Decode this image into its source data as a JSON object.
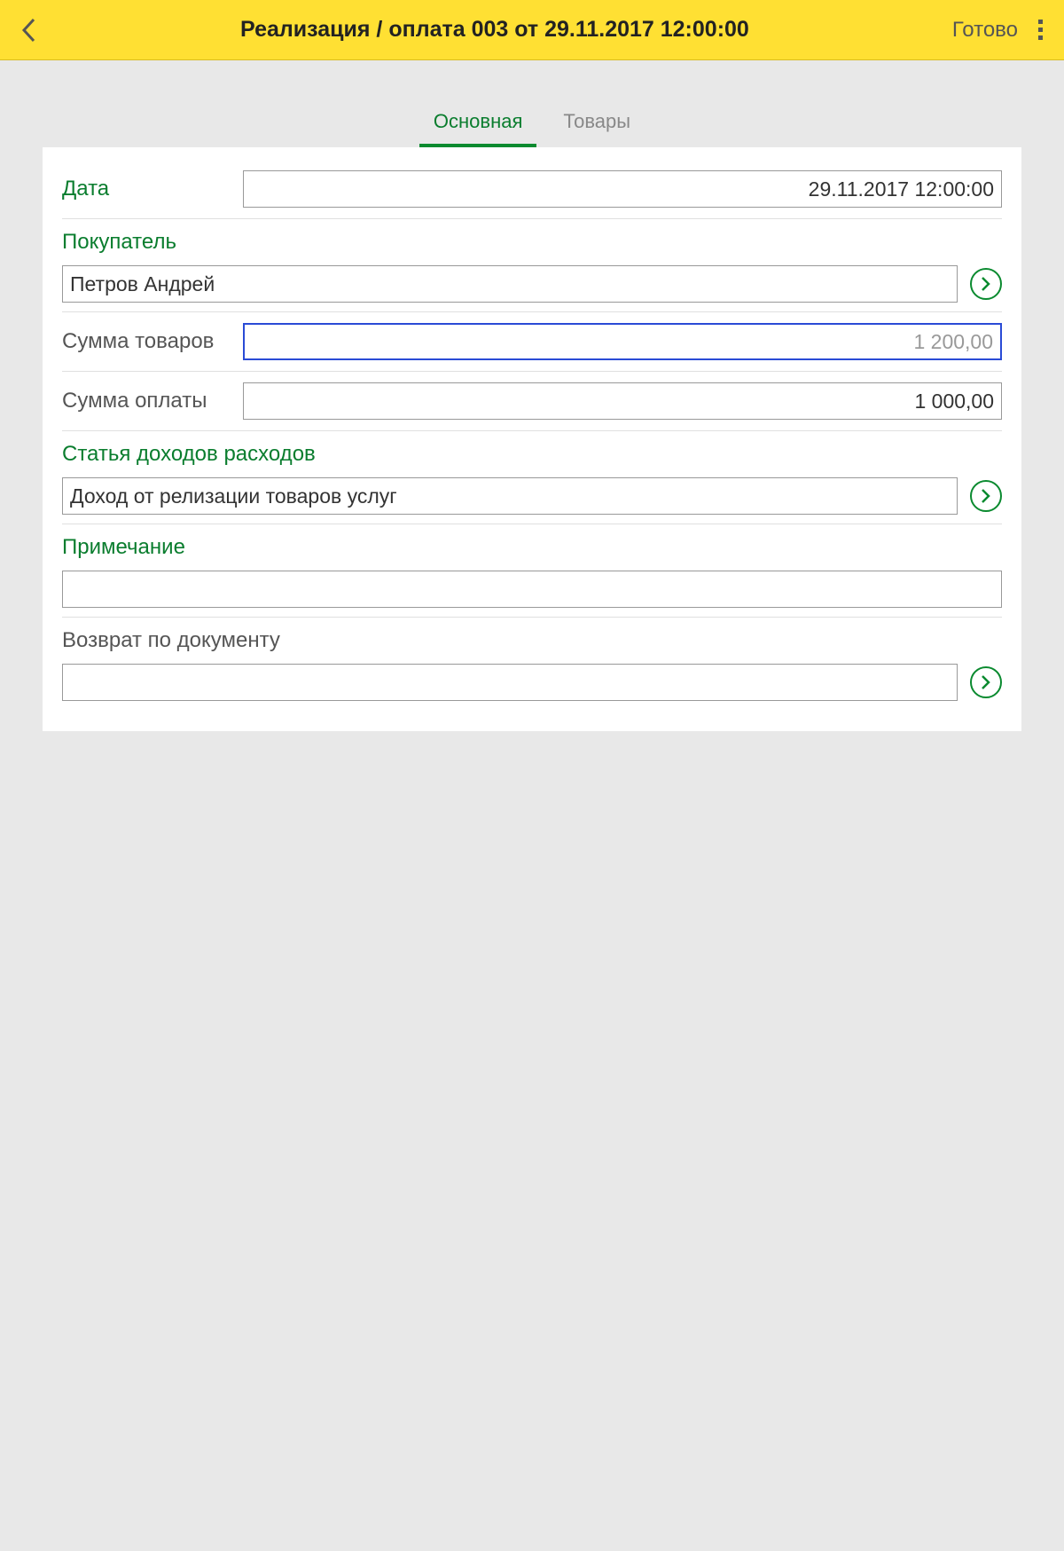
{
  "header": {
    "title": "Реализация / оплата 003 от 29.11.2017 12:00:00",
    "done_label": "Готово"
  },
  "tabs": {
    "main": "Основная",
    "goods": "Товары"
  },
  "form": {
    "date": {
      "label": "Дата",
      "value": "29.11.2017 12:00:00"
    },
    "buyer": {
      "label": "Покупатель",
      "value": "Петров Андрей"
    },
    "goods_sum": {
      "label": "Сумма товаров",
      "value": "1 200,00"
    },
    "payment_sum": {
      "label": "Сумма оплаты",
      "value": "1 000,00"
    },
    "income_article": {
      "label": "Статья доходов расходов",
      "value": "Доход от релизации товаров услуг"
    },
    "note": {
      "label": "Примечание",
      "value": ""
    },
    "return_doc": {
      "label": "Возврат по документу",
      "value": ""
    }
  }
}
